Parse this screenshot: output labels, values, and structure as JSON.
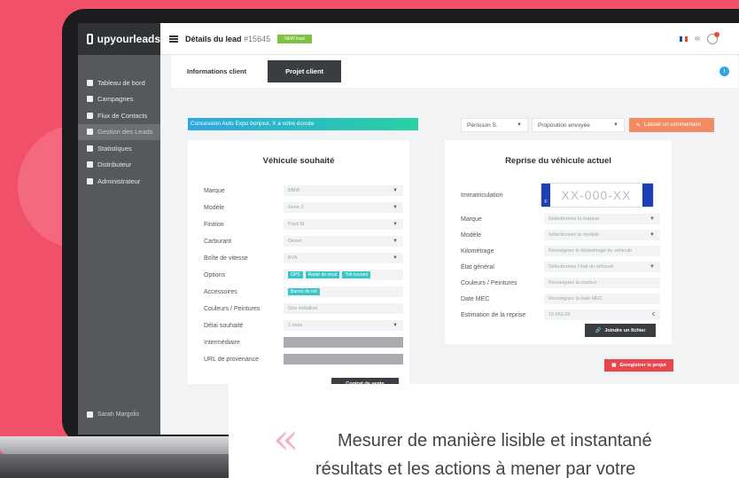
{
  "brand": {
    "name": "upyourleads"
  },
  "sidebar": {
    "items": [
      {
        "label": "Tableau de bord",
        "icon": "dashboard-icon"
      },
      {
        "label": "Campagnes",
        "icon": "megaphone-icon"
      },
      {
        "label": "Flux de Contacts",
        "icon": "users-icon"
      },
      {
        "label": "Gestion des Leads",
        "icon": "leads-icon",
        "active": true
      },
      {
        "label": "Statistiques",
        "icon": "stats-icon"
      },
      {
        "label": "Distributeur",
        "icon": "distributor-icon"
      },
      {
        "label": "Administrateur",
        "icon": "admin-icon"
      }
    ],
    "user": "Sarah Margolis"
  },
  "header": {
    "title": "Détails du lead",
    "lead_number": "#15645",
    "status": "NEW lead"
  },
  "tabs": [
    {
      "label": "Informations client"
    },
    {
      "label": "Projet client",
      "active": true
    }
  ],
  "actions": {
    "banner": "Concession Auto Expo bonjour, X a votre écoute",
    "assignee": "Pénisson S.",
    "proposal": "Proposition envoyée",
    "comment_button": "Laisser un commentaire"
  },
  "vehicle_wanted": {
    "title": "Véhicule souhaité",
    "fields": [
      {
        "label": "Marque",
        "value": "BMW"
      },
      {
        "label": "Modèle",
        "value": "Serie 2"
      },
      {
        "label": "Finition",
        "value": "Pack M"
      },
      {
        "label": "Carburant",
        "value": "Diesel"
      },
      {
        "label": "Boîte de vitesse",
        "value": "BVA"
      },
      {
        "label": "Options",
        "tags": [
          "GPS",
          "Radar de recul",
          "Toit ouvrant"
        ]
      },
      {
        "label": "Accessoires",
        "tags": [
          "Barres de toit"
        ]
      },
      {
        "label": "Couleurs / Peintures",
        "value": "Gris métallisé"
      },
      {
        "label": "Délai souhaité",
        "value": "2 mois"
      },
      {
        "label": "Intermédiaire",
        "value": ""
      },
      {
        "label": "URL de provenance",
        "value": ""
      }
    ],
    "save_partial": "Contrat de vente"
  },
  "trade_in": {
    "title": "Reprise du véhicule actuel",
    "plate_label": "Immatriculation",
    "plate_value": "XX-000-XX",
    "plate_country": "F",
    "fields": [
      {
        "label": "Marque",
        "value": "Sélectionnez la marque"
      },
      {
        "label": "Modèle",
        "value": "Sélectionnez le modèle"
      },
      {
        "label": "Kilométrage",
        "value": "Renseignez le kilométrage du véhicule"
      },
      {
        "label": "État général",
        "value": "Sélectionnez l'état du véhicule"
      },
      {
        "label": "Couleurs / Peintures",
        "value": "Renseignez la couleur"
      },
      {
        "label": "Date MEC",
        "value": "Renseignez la date MEC"
      },
      {
        "label": "Estimation de la reprise",
        "value": "15 652.00",
        "unit": "€"
      }
    ],
    "attach_button": "Joindre un fichier",
    "save_button": "Enregistrer le projet"
  },
  "quote": {
    "line1": "Mesurer de manière lisible et instantané",
    "line2": "résultats et les actions à mener par votre"
  }
}
